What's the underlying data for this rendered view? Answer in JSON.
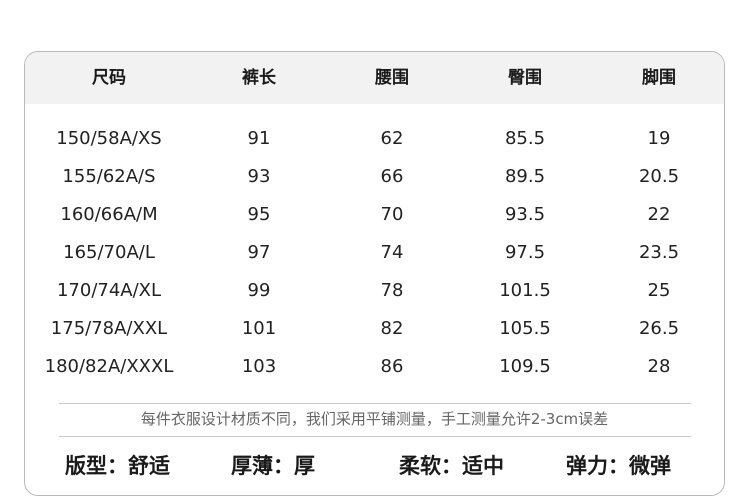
{
  "table": {
    "headers": [
      "尺码",
      "裤长",
      "腰围",
      "臀围",
      "脚围"
    ],
    "rows": [
      [
        "150/58A/XS",
        "91",
        "62",
        "85.5",
        "19"
      ],
      [
        "155/62A/S",
        "93",
        "66",
        "89.5",
        "20.5"
      ],
      [
        "160/66A/M",
        "95",
        "70",
        "93.5",
        "22"
      ],
      [
        "165/70A/L",
        "97",
        "74",
        "97.5",
        "23.5"
      ],
      [
        "170/74A/XL",
        "99",
        "78",
        "101.5",
        "25"
      ],
      [
        "175/78A/XXL",
        "101",
        "82",
        "105.5",
        "26.5"
      ],
      [
        "180/82A/XXXL",
        "103",
        "86",
        "109.5",
        "28"
      ]
    ]
  },
  "note": "每件衣服设计材质不同，我们采用平铺测量，手工测量允许2-3cm误差",
  "properties": [
    "版型：舒适",
    "厚薄：厚",
    "柔软：适中",
    "弹力：微弹"
  ]
}
